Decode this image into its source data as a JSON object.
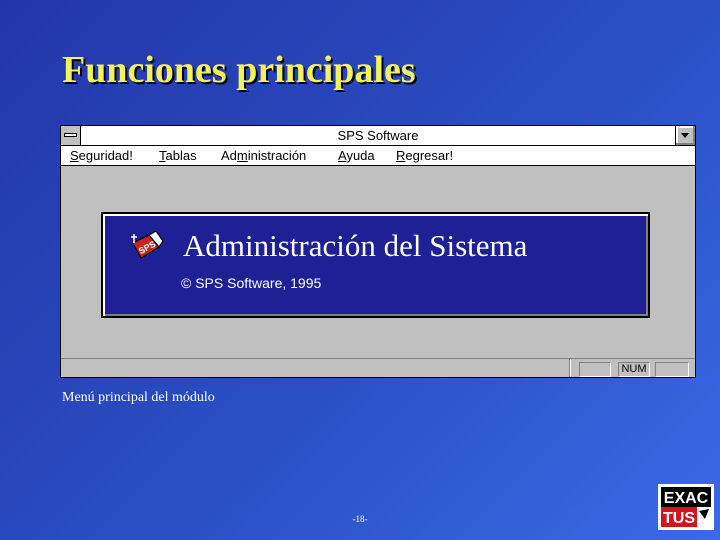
{
  "slide": {
    "title": "Funciones principales",
    "caption": "Menú principal del módulo",
    "page_number": "-18-"
  },
  "window": {
    "title": "SPS Software",
    "menu": [
      {
        "prefix": "",
        "accel": "S",
        "suffix": "eguridad!"
      },
      {
        "prefix": "",
        "accel": "T",
        "suffix": "ablas"
      },
      {
        "prefix": "Ad",
        "accel": "m",
        "suffix": "inistración"
      },
      {
        "prefix": "",
        "accel": "A",
        "suffix": "yuda"
      },
      {
        "prefix": "",
        "accel": "R",
        "suffix": "egresar!"
      }
    ],
    "banner": {
      "title": "Administración del Sistema",
      "copyright": "© SPS Software, 1995",
      "icon": "sps-logo-icon"
    },
    "status": {
      "num_indicator": "NUM"
    }
  },
  "logo": {
    "line1": "EXAC",
    "line2": "TUS",
    "colors": {
      "red": "#d4141c",
      "black": "#000000"
    }
  },
  "colors": {
    "title_yellow": "#f2f25a",
    "banner_blue": "#1f1f96",
    "window_gray": "#c0c0c0"
  }
}
